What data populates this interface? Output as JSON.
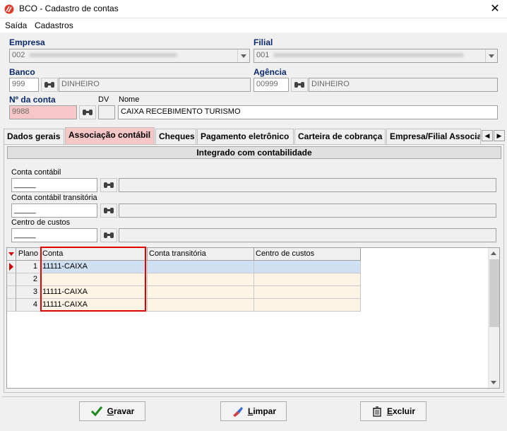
{
  "window": {
    "title": "BCO - Cadastro de contas",
    "close_icon": "close-icon"
  },
  "menu": {
    "items": [
      "Saída",
      "Cadastros"
    ]
  },
  "form": {
    "empresa_label": "Empresa",
    "empresa_value": "002",
    "filial_label": "Filial",
    "filial_value": "001",
    "banco_label": "Banco",
    "banco_code": "999",
    "banco_name": "DINHEIRO",
    "agencia_label": "Agência",
    "agencia_code": "00999",
    "agencia_name": "DINHEIRO",
    "conta_label": "Nº da conta",
    "conta_value": "9988",
    "dv_label": "DV",
    "dv_value": "",
    "nome_label": "Nome",
    "nome_value": "CAIXA RECEBIMENTO TURISMO"
  },
  "tabs": [
    {
      "label": "Dados gerais"
    },
    {
      "label": "Associação contábil"
    },
    {
      "label": "Cheques"
    },
    {
      "label": "Pagamento eletrônico"
    },
    {
      "label": "Carteira de cobrança"
    },
    {
      "label": "Empresa/Filial Associa"
    }
  ],
  "active_tab": "Associação contábil",
  "panel": {
    "header": "Integrado com contabilidade",
    "conta_contabil_label": "Conta contábil",
    "conta_contabil_value": "_____",
    "conta_transitoria_label": "Conta contábil transitória",
    "conta_transitoria_value": "_____",
    "centro_custos_label": "Centro de custos",
    "centro_custos_value": "_____"
  },
  "grid": {
    "columns": [
      "Plano",
      "Conta",
      "Conta transitória",
      "Centro de custos"
    ],
    "rows": [
      {
        "plano": "1",
        "conta": "11111-CAIXA",
        "transitoria": "",
        "centro": ""
      },
      {
        "plano": "2",
        "conta": "",
        "transitoria": "",
        "centro": ""
      },
      {
        "plano": "3",
        "conta": "11111-CAIXA",
        "transitoria": "",
        "centro": ""
      },
      {
        "plano": "4",
        "conta": "11111-CAIXA",
        "transitoria": "",
        "centro": ""
      }
    ]
  },
  "buttons": {
    "gravar_first": "G",
    "gravar_rest": "ravar",
    "limpar_first": "L",
    "limpar_rest": "impar",
    "excluir_first": "E",
    "excluir_rest": "xcluir"
  },
  "colors": {
    "accent_pink": "#f7c6c6",
    "label_blue": "#0a2a6a",
    "highlight_red": "#e00000",
    "selected_row": "#cfe0f3"
  }
}
